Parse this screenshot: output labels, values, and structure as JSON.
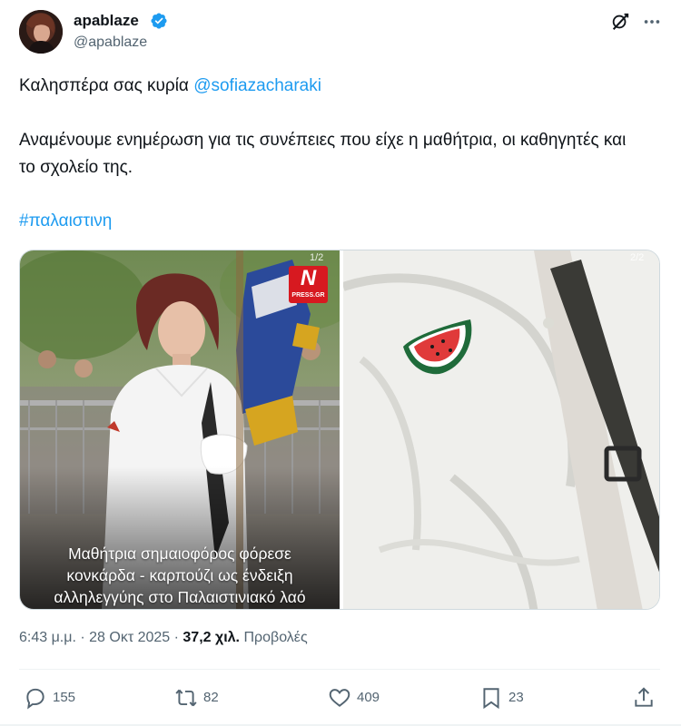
{
  "author": {
    "name": "apablaze",
    "handle": "@apablaze",
    "verified": true
  },
  "tweet": {
    "line1_text": "Καλησπέρα σας κυρία ",
    "mention": "@sofiazacharaki",
    "paragraph2": "Αναμένουμε ενημέρωση για τις συνέπειες που είχε η μαθήτρια, οι καθηγητές και το σχολείο της.",
    "hashtag": "#παλαιστινη"
  },
  "media": [
    {
      "counter": "1/2",
      "badge": {
        "letter": "N",
        "text": "PRESS.GR"
      },
      "caption_lines": [
        "Μαθήτρια σημαιοφόρος φόρεσε",
        "κονκάρδα - καρπούζι ως ένδειξη",
        "αλληλεγγύης στο Παλαιστινιακό λαό"
      ]
    },
    {
      "counter": "2/2"
    }
  ],
  "meta": {
    "time": "6:43 μ.μ.",
    "date": "28 Οκτ 2025",
    "views_count": "37,2 χιλ.",
    "views_label": "Προβολές"
  },
  "actions": {
    "replies": "155",
    "retweets": "82",
    "likes": "409",
    "bookmarks": "23"
  },
  "icons": {
    "verified": "verified-badge-icon",
    "grok": "grok-icon",
    "more": "more-icon",
    "reply": "reply-icon",
    "retweet": "retweet-icon",
    "like": "heart-icon",
    "bookmark": "bookmark-icon",
    "share": "share-icon"
  },
  "colors": {
    "accent": "#1d9bf0",
    "text": "#0f1419",
    "secondary": "#536471"
  }
}
